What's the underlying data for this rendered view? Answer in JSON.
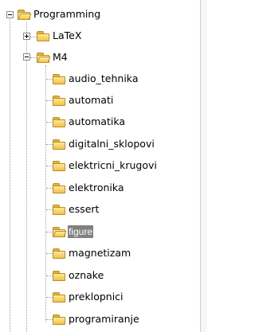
{
  "tree": {
    "root": {
      "label": "Programming",
      "expanded": true,
      "icon": "folder-open-icon"
    },
    "level1": [
      {
        "label": "LaTeX",
        "expanded": false,
        "icon": "folder-icon"
      },
      {
        "label": "M4",
        "expanded": true,
        "icon": "folder-open-icon"
      }
    ],
    "m4_children": [
      {
        "label": "audio_tehnika",
        "icon": "folder-icon"
      },
      {
        "label": "automati",
        "icon": "folder-icon"
      },
      {
        "label": "automatika",
        "icon": "folder-icon"
      },
      {
        "label": "digitalni_sklopovi",
        "icon": "folder-icon"
      },
      {
        "label": "elektricni_krugovi",
        "icon": "folder-icon"
      },
      {
        "label": "elektronika",
        "icon": "folder-icon"
      },
      {
        "label": "essert",
        "icon": "folder-icon"
      },
      {
        "label": "figure",
        "icon": "folder-open-icon",
        "selected": true
      },
      {
        "label": "magnetizam",
        "icon": "folder-icon"
      },
      {
        "label": "oznake",
        "icon": "folder-icon"
      },
      {
        "label": "preklopnici",
        "icon": "folder-icon"
      },
      {
        "label": "programiranje",
        "icon": "folder-icon"
      }
    ],
    "selection_color": "#808080",
    "folder_color": "#f0c24d"
  }
}
